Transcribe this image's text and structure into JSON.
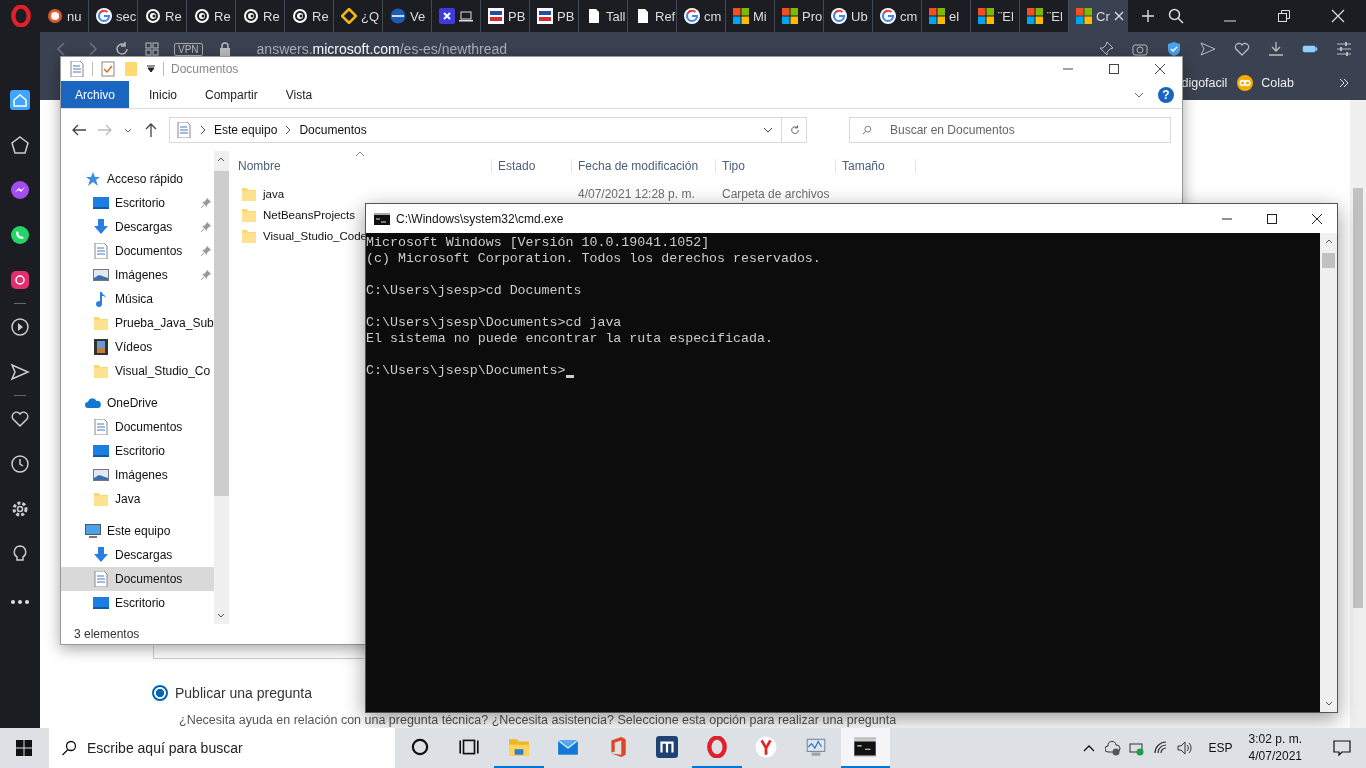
{
  "browser": {
    "tabs": [
      {
        "title": "nu",
        "kind": "duck",
        "selected": false
      },
      {
        "title": "sec",
        "kind": "google",
        "selected": false
      },
      {
        "title": "Re",
        "kind": "swirl",
        "selected": false
      },
      {
        "title": "Re",
        "kind": "swirl",
        "selected": false
      },
      {
        "title": "Re",
        "kind": "swirl",
        "selected": false
      },
      {
        "title": "Re",
        "kind": "swirl",
        "selected": false
      },
      {
        "title": "¿Q",
        "kind": "diamond",
        "selected": false
      },
      {
        "title": "Ve",
        "kind": "globe",
        "selected": false
      },
      {
        "kind": "square",
        "selected": false
      },
      {
        "title": "PB",
        "kind": "badge",
        "selected": false
      },
      {
        "title": "PB",
        "kind": "badge",
        "selected": false
      },
      {
        "title": "Tall",
        "kind": "doc",
        "selected": false
      },
      {
        "title": "Ref",
        "kind": "doc",
        "selected": false
      },
      {
        "title": "cm",
        "kind": "google",
        "selected": false
      },
      {
        "title": "Mi",
        "kind": "windows",
        "selected": false
      },
      {
        "title": "Pro",
        "kind": "windows",
        "selected": false
      },
      {
        "title": "Ub",
        "kind": "google",
        "selected": false
      },
      {
        "title": "cm",
        "kind": "google",
        "selected": false
      },
      {
        "title": "el",
        "kind": "windows",
        "selected": false
      },
      {
        "title": "¨El",
        "kind": "windows",
        "selected": false
      },
      {
        "title": "¨El",
        "kind": "windows",
        "selected": false
      },
      {
        "title": "Cr",
        "kind": "windows",
        "selected": true
      }
    ],
    "vpn": "VPN",
    "url_start": "answers.",
    "url_host": "microsoft.com",
    "url_path": "/es-es/newthread",
    "bookmarks": [
      {
        "label": "digofacil",
        "kind": "plain"
      },
      {
        "label": "Colab",
        "kind": "colab"
      }
    ],
    "option": {
      "label": "Publicar una pregunta",
      "selected": true
    },
    "description": "¿Necesita ayuda en relación con una pregunta técnica? ¿Necesita asistencia? Seleccione esta opción para realizar una pregunta"
  },
  "explorer": {
    "title": "Documentos",
    "help": "?",
    "ribbon_tabs": [
      {
        "label": "Archivo",
        "selected": true
      },
      {
        "label": "Inicio",
        "selected": false
      },
      {
        "label": "Compartir",
        "selected": false
      },
      {
        "label": "Vista",
        "selected": false
      }
    ],
    "breadcrumb": [
      "Este equipo",
      "Documentos"
    ],
    "search": {
      "placeholder": "Buscar en Documentos"
    },
    "nav": [
      {
        "label": "Acceso rápido",
        "kind": "star",
        "selected": false,
        "children": [
          {
            "label": "Escritorio",
            "kind": "desktop",
            "pinned": true,
            "selected": false
          },
          {
            "label": "Descargas",
            "kind": "download",
            "pinned": true,
            "selected": false
          },
          {
            "label": "Documentos",
            "kind": "document",
            "pinned": true,
            "selected": false
          },
          {
            "label": "Imágenes",
            "kind": "image",
            "pinned": true,
            "selected": false
          },
          {
            "label": "Música",
            "kind": "music",
            "pinned": false,
            "selected": false
          },
          {
            "label": "Prueba_Java_Sub",
            "kind": "folder",
            "pinned": false,
            "selected": false
          },
          {
            "label": "Vídeos",
            "kind": "film",
            "pinned": false,
            "selected": false
          },
          {
            "label": "Visual_Studio_Co",
            "kind": "folder",
            "pinned": false,
            "selected": false
          }
        ]
      },
      {
        "label": "OneDrive",
        "kind": "cloud",
        "selected": false,
        "children": [
          {
            "label": "Documentos",
            "kind": "document",
            "pinned": false,
            "selected": false
          },
          {
            "label": "Escritorio",
            "kind": "desktop",
            "pinned": false,
            "selected": false
          },
          {
            "label": "Imágenes",
            "kind": "image",
            "pinned": false,
            "selected": false
          },
          {
            "label": "Java",
            "kind": "folder",
            "pinned": false,
            "selected": false
          }
        ]
      },
      {
        "label": "Este equipo",
        "kind": "computer",
        "selected": false,
        "children": [
          {
            "label": "Descargas",
            "kind": "download",
            "pinned": false,
            "selected": false
          },
          {
            "label": "Documentos",
            "kind": "document",
            "pinned": false,
            "selected": true
          },
          {
            "label": "Escritorio",
            "kind": "desktop",
            "pinned": false,
            "selected": false
          }
        ]
      }
    ],
    "columns": [
      "Nombre",
      "Estado",
      "Fecha de modificación",
      "Tipo",
      "Tamaño"
    ],
    "files": [
      {
        "name": "java",
        "modified": "4/07/2021 12:28 p. m.",
        "type": "Carpeta de archivos"
      },
      {
        "name": "NetBeansProjects"
      },
      {
        "name": "Visual_Studio_Code"
      }
    ],
    "status": "3 elementos"
  },
  "cmd": {
    "title": "C:\\Windows\\system32\\cmd.exe",
    "cursor": true,
    "blocks": [
      [
        "Microsoft Windows [Versión 10.0.19041.1052]",
        "(c) Microsoft Corporation. Todos los derechos reservados."
      ],
      [
        "C:\\Users\\jsesp>cd Documents"
      ],
      [
        "C:\\Users\\jsesp\\Documents>cd java",
        "El sistema no puede encontrar la ruta especificada."
      ],
      [
        "C:\\Users\\jsesp\\Documents>"
      ]
    ]
  },
  "taskbar": {
    "search_placeholder": "Escribe aquí para buscar",
    "apps": [
      {
        "kind": "cortana",
        "running": false,
        "selected": false
      },
      {
        "kind": "taskview",
        "running": false,
        "selected": false
      },
      {
        "kind": "folder",
        "running": true,
        "selected": false
      },
      {
        "kind": "mail",
        "running": false,
        "selected": false
      },
      {
        "kind": "office",
        "running": false,
        "selected": false
      },
      {
        "kind": "maxthon",
        "running": false,
        "selected": false
      },
      {
        "kind": "opera",
        "running": true,
        "selected": false
      },
      {
        "kind": "yandex",
        "running": false,
        "selected": false
      },
      {
        "kind": "monitor",
        "running": false,
        "selected": false
      },
      {
        "kind": "console",
        "running": true,
        "selected": true
      }
    ],
    "language": "ESP",
    "time": "3:02 p. m.",
    "date": "4/07/2021"
  }
}
